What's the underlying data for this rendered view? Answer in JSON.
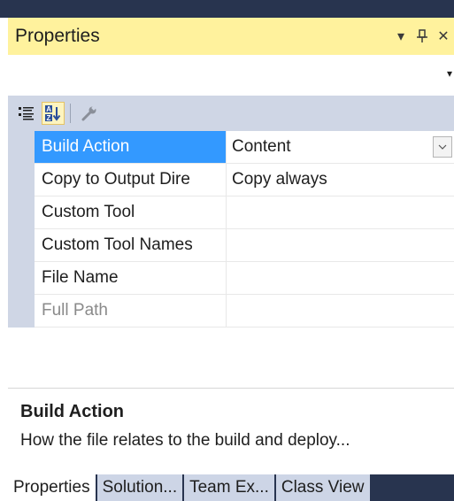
{
  "window": {
    "title": "Properties",
    "controls": {
      "dropdown_icon": "chevron-down-icon",
      "pin_icon": "pin-icon",
      "close_icon": "close-icon",
      "dropdown_glyph": "▾",
      "pin_glyph": "ꟸ",
      "close_glyph": "✕"
    }
  },
  "object_selector": {
    "value": "",
    "arrow": "▾"
  },
  "toolbar": {
    "buttons": [
      {
        "name": "categorized-view",
        "icon": "categorized-icon",
        "active": false
      },
      {
        "name": "alphabetical-view",
        "icon": "sort-alphabetical-icon",
        "active": true
      },
      {
        "name": "property-pages",
        "icon": "wrench-icon",
        "active": false
      }
    ]
  },
  "properties": [
    {
      "name": "Build Action",
      "value": "Content",
      "selected": true,
      "disabled": false,
      "has_dropdown": true
    },
    {
      "name": "Copy to Output Dire",
      "value": "Copy always",
      "selected": false,
      "disabled": false
    },
    {
      "name": "Custom Tool",
      "value": "",
      "selected": false,
      "disabled": false
    },
    {
      "name": "Custom Tool Names",
      "value": "",
      "selected": false,
      "disabled": false
    },
    {
      "name": "File Name",
      "value": "",
      "selected": false,
      "disabled": false
    },
    {
      "name": "Full Path",
      "value": "",
      "selected": false,
      "disabled": true
    }
  ],
  "description": {
    "title": "Build Action",
    "text": "How the file relates to the build and deploy..."
  },
  "bottom_tabs": [
    {
      "label": "Properties",
      "active": true
    },
    {
      "label": "Solution...",
      "active": false
    },
    {
      "label": "Team Ex...",
      "active": false
    },
    {
      "label": "Class View",
      "active": false
    }
  ]
}
